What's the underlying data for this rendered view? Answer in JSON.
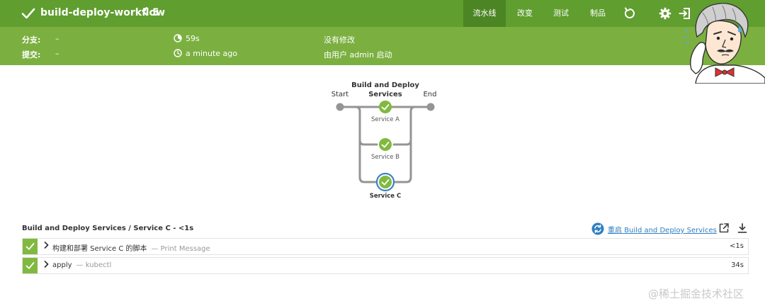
{
  "header": {
    "title": "build-deploy-workflow",
    "run_number": "5",
    "tabs": [
      {
        "label": "流水线",
        "active": true
      },
      {
        "label": "改变",
        "active": false
      },
      {
        "label": "测试",
        "active": false
      },
      {
        "label": "制品",
        "active": false
      }
    ],
    "icons": [
      "check-icon",
      "chevron-left-icon",
      "replay-icon",
      "gear-icon",
      "logout-icon"
    ]
  },
  "summary": {
    "branch_label": "分支:",
    "branch_value": "–",
    "commit_label": "提交:",
    "commit_value": "–",
    "duration": "59s",
    "time_ago": "a minute ago",
    "changes": "没有修改",
    "started_by": "由用户 admin 启动"
  },
  "graph": {
    "start_label": "Start",
    "end_label": "End",
    "stage_title_line1": "Build and Deploy",
    "stage_title_line2": "Services",
    "branches": [
      {
        "label": "Service A",
        "status": "success",
        "selected": false
      },
      {
        "label": "Service B",
        "status": "success",
        "selected": false
      },
      {
        "label": "Service C",
        "status": "success",
        "selected": true
      }
    ]
  },
  "steps": {
    "title": "Build and Deploy Services / Service C - <1s",
    "restart_prefix": "重启",
    "restart_target": "Build and Deploy Services",
    "rows": [
      {
        "name": "构建和部署 Service C 的脚本",
        "desc": "— Print Message",
        "duration": "<1s",
        "status": "success"
      },
      {
        "name": "apply",
        "desc": "— kubectl",
        "duration": "34s",
        "status": "success"
      }
    ]
  },
  "colors": {
    "top_bar": "#5f9e2f",
    "sub_bar": "#7bb041",
    "success": "#80b940",
    "selected_ring": "#3b82c4",
    "link": "#2f7fc2"
  },
  "watermark": "@稀土掘金技术社区"
}
